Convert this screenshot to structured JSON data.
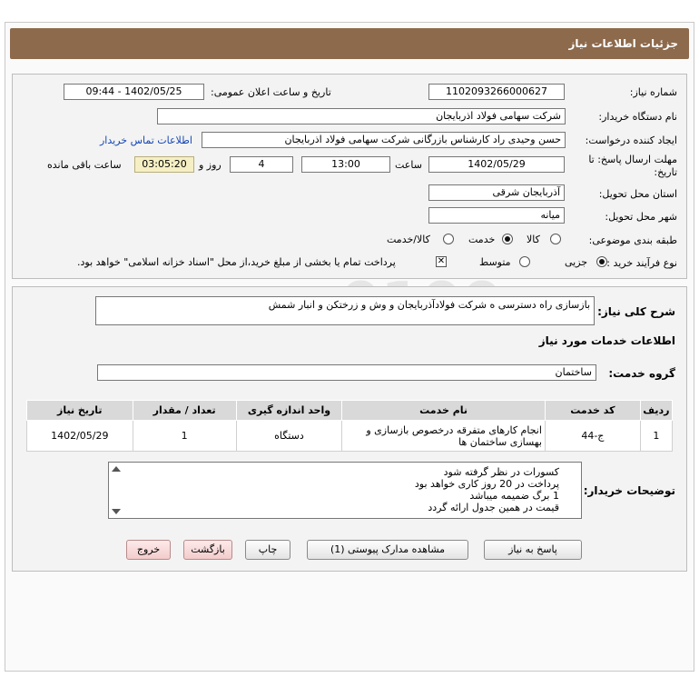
{
  "header": {
    "title": "جزئیات اطلاعات نیاز"
  },
  "details": {
    "need_number_label": "شماره نیاز:",
    "need_number": "1102093266000627",
    "announce_label": "تاریخ و ساعت اعلان عمومی:",
    "announce_value": "1402/05/25 - 09:44",
    "buyer_org_label": "نام دستگاه خریدار:",
    "buyer_org": "شرکت سهامی فولاد اذربایجان",
    "creator_label": "ایجاد کننده درخواست:",
    "creator": "حسن وحیدی راد کارشناس بازرگانی شرکت سهامی فولاد اذربایجان",
    "contact_link": "اطلاعات تماس خریدار",
    "deadline_label_1": "مهلت ارسال پاسخ: تا",
    "deadline_label_2": "تاریخ:",
    "deadline_date": "1402/05/29",
    "time_label": "ساعت",
    "deadline_time": "13:00",
    "days_value": "4",
    "days_label": "روز و",
    "remaining_time": "03:05:20",
    "remaining_label": "ساعت باقی مانده",
    "province_label": "استان محل تحویل:",
    "province": "آذربایجان شرقی",
    "city_label": "شهر محل تحویل:",
    "city": "میانه",
    "category_label": "طبقه بندی موضوعی:",
    "category_options": [
      "کالا",
      "خدمت",
      "کالا/خدمت"
    ],
    "category_selected": "خدمت",
    "purchase_type_label": "نوع فرآیند خرید :",
    "purchase_options": [
      "جزیی",
      "متوسط"
    ],
    "purchase_selected": "جزیی",
    "treasury_note": "پرداخت تمام یا بخشی از مبلغ خرید،از محل \"اسناد خزانه اسلامی\" خواهد بود."
  },
  "general": {
    "description_label": "شرح کلی نیاز:",
    "description": "بازسازی راه دسترسی ه شرکت فولادآذربایجان و وش و زرختکن و انبار شمش",
    "services_heading": "اطلاعات خدمات مورد نیاز",
    "service_group_label": "گروه خدمت:",
    "service_group": "ساختمان"
  },
  "table": {
    "headers": [
      "ردیف",
      "کد خدمت",
      "نام خدمت",
      "واحد اندازه گیری",
      "تعداد / مقدار",
      "تاریخ نیاز"
    ],
    "rows": [
      [
        "1",
        "ج-44",
        "انجام کارهای متفرقه درخصوص بازسازی و بهسازی ساختمان ها",
        "دستگاه",
        "1",
        "1402/05/29"
      ]
    ]
  },
  "buyer_notes": {
    "label": "توضیحات خریدار:",
    "lines": [
      "کسورات در نظر گرفته شود",
      "پرداخت در 20 روز کاری خواهد بود",
      "1 برگ ضمیمه میباشد",
      "قیمت در همین جدول ارائه گردد"
    ]
  },
  "buttons": {
    "respond": "پاسخ به نیاز",
    "attachments": "مشاهده مدارک پیوستی (1)",
    "print": "چاپ",
    "back": "بازگشت",
    "exit": "خروج"
  }
}
